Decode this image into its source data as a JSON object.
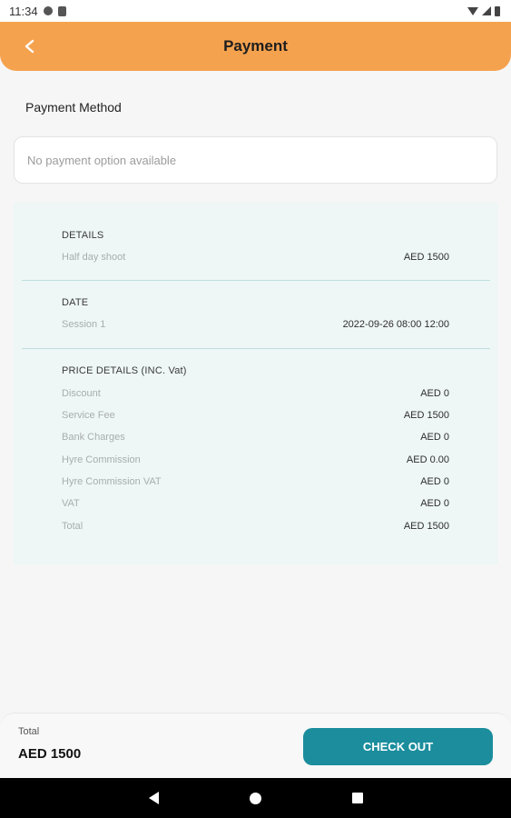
{
  "status_bar": {
    "time": "11:34"
  },
  "header": {
    "title": "Payment"
  },
  "payment_method": {
    "label": "Payment Method",
    "empty_text": "No payment option available"
  },
  "details": {
    "heading": "DETAILS",
    "item": "Half day shoot",
    "price": "AED 1500"
  },
  "date": {
    "heading": "DATE",
    "session": "Session 1",
    "datetime": "2022-09-26 08:00 12:00"
  },
  "price_details": {
    "heading": "PRICE DETAILS (INC. Vat)",
    "rows": [
      {
        "label": "Discount",
        "value": "AED 0"
      },
      {
        "label": "Service Fee",
        "value": "AED 1500"
      },
      {
        "label": "Bank Charges",
        "value": "AED 0"
      },
      {
        "label": "Hyre Commission",
        "value": "AED 0.00"
      },
      {
        "label": "Hyre Commission VAT",
        "value": "AED 0"
      },
      {
        "label": "VAT",
        "value": "AED 0"
      },
      {
        "label": "Total",
        "value": "AED 1500"
      }
    ]
  },
  "footer": {
    "total_label": "Total",
    "total_value": "AED 1500",
    "checkout_label": "CHECK OUT"
  },
  "colors": {
    "header_bg": "#f5a24f",
    "accent": "#1b8d9d",
    "card_bg": "#eef6f6"
  },
  "icons": [
    "back-arrow-icon",
    "wifi-icon",
    "signal-icon",
    "battery-icon",
    "nav-back-icon",
    "nav-home-icon",
    "nav-recents-icon"
  ]
}
